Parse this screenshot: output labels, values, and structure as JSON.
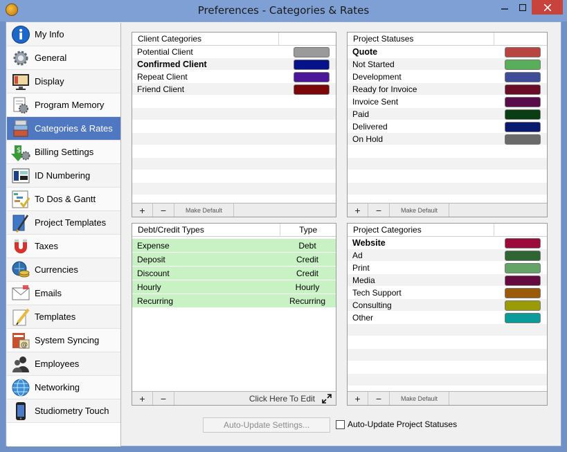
{
  "window": {
    "title": "Preferences - Categories & Rates"
  },
  "sidebar": {
    "items": [
      {
        "label": "My Info",
        "icon": "info-icon"
      },
      {
        "label": "General",
        "icon": "gear-icon"
      },
      {
        "label": "Display",
        "icon": "monitor-icon"
      },
      {
        "label": "Program Memory",
        "icon": "memory-icon"
      },
      {
        "label": "Categories & Rates",
        "icon": "categories-icon",
        "selected": true
      },
      {
        "label": "Billing Settings",
        "icon": "billing-icon"
      },
      {
        "label": "ID Numbering",
        "icon": "id-numbering-icon"
      },
      {
        "label": "To Dos & Gantt",
        "icon": "todo-icon"
      },
      {
        "label": "Project Templates",
        "icon": "project-templates-icon"
      },
      {
        "label": "Taxes",
        "icon": "magnet-icon"
      },
      {
        "label": "Currencies",
        "icon": "currency-icon"
      },
      {
        "label": "Emails",
        "icon": "email-icon"
      },
      {
        "label": "Templates",
        "icon": "pencil-icon"
      },
      {
        "label": "System Syncing",
        "icon": "sync-icon"
      },
      {
        "label": "Employees",
        "icon": "employees-icon"
      },
      {
        "label": "Networking",
        "icon": "globe-icon"
      },
      {
        "label": "Studiometry Touch",
        "icon": "phone-icon"
      }
    ]
  },
  "client_categories": {
    "header": "Client Categories",
    "items": [
      {
        "name": "Potential Client",
        "color": "#9a9a9a",
        "bold": false
      },
      {
        "name": "Confirmed Client",
        "color": "#07118a",
        "bold": true
      },
      {
        "name": "Repeat Client",
        "color": "#4b1697",
        "bold": false
      },
      {
        "name": "Friend Client",
        "color": "#7c0709",
        "bold": false
      }
    ],
    "make_default": "Make Default"
  },
  "project_statuses": {
    "header": "Project Statuses",
    "items": [
      {
        "name": "Quote",
        "color": "#b84540",
        "bold": true
      },
      {
        "name": "Not Started",
        "color": "#59ae5a",
        "bold": false
      },
      {
        "name": "Development",
        "color": "#3f4c97",
        "bold": false
      },
      {
        "name": "Ready for Invoice",
        "color": "#6a0d27",
        "bold": false
      },
      {
        "name": "Invoice Sent",
        "color": "#5a0b4a",
        "bold": false
      },
      {
        "name": "Paid",
        "color": "#0b3d14",
        "bold": false
      },
      {
        "name": "Delivered",
        "color": "#0a1a6e",
        "bold": false
      },
      {
        "name": "On Hold",
        "color": "#6a6a6a",
        "bold": false
      }
    ],
    "make_default": "Make Default"
  },
  "debit_credit": {
    "header_name": "Debt/Credit Types",
    "header_type": "Type",
    "items": [
      {
        "name": "Expense",
        "type": "Debt"
      },
      {
        "name": "Deposit",
        "type": "Credit"
      },
      {
        "name": "Discount",
        "type": "Credit"
      },
      {
        "name": "Hourly",
        "type": "Hourly"
      },
      {
        "name": "Recurring",
        "type": "Recurring"
      }
    ],
    "click_to_edit": "Click Here To Edit"
  },
  "project_categories": {
    "header": "Project Categories",
    "items": [
      {
        "name": "Website",
        "color": "#9a0b3c",
        "bold": true
      },
      {
        "name": "Ad",
        "color": "#2f6532",
        "bold": false
      },
      {
        "name": "Print",
        "color": "#64a567",
        "bold": false
      },
      {
        "name": "Media",
        "color": "#650b3f",
        "bold": false
      },
      {
        "name": "Tech Support",
        "color": "#9b5a07",
        "bold": false
      },
      {
        "name": "Consulting",
        "color": "#9b9b07",
        "bold": false
      },
      {
        "name": "Other",
        "color": "#0c9b9b",
        "bold": false
      }
    ],
    "make_default": "Make Default"
  },
  "toolbar": {
    "plus": "+",
    "minus": "−"
  },
  "footer": {
    "auto_update_button": "Auto-Update Settings...",
    "auto_update_check": "Auto-Update Project Statuses"
  }
}
